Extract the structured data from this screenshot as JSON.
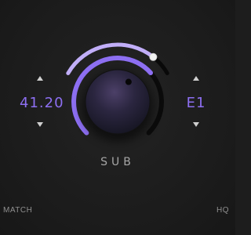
{
  "colors": {
    "accent": "#8d6ff2",
    "accent_light": "#c1aef8",
    "panel": "#1d1d1d",
    "text_dim": "#a6a6a6"
  },
  "left_value": {
    "text": "41.20",
    "arrows": [
      "up-arrow",
      "down-arrow"
    ]
  },
  "right_value": {
    "text": "E1",
    "arrows": [
      "up-arrow",
      "down-arrow"
    ]
  },
  "knob": {
    "label": "SUB",
    "main_level": 0.68,
    "secondary_level": 0.82
  },
  "footer": {
    "left_label": "MATCH",
    "right_label": "HQ"
  }
}
